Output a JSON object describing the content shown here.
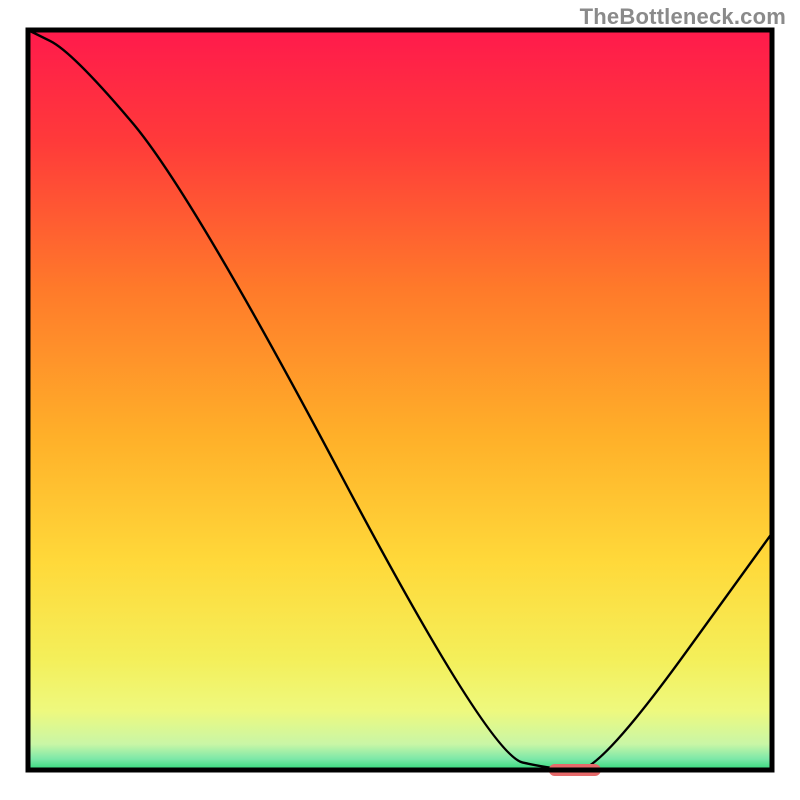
{
  "watermark": "TheBottleneck.com",
  "chart_data": {
    "type": "line",
    "title": "",
    "xlabel": "",
    "ylabel": "",
    "xlim": [
      0,
      100
    ],
    "ylim": [
      0,
      100
    ],
    "x": [
      0,
      6,
      22,
      62,
      71,
      77,
      100
    ],
    "values": [
      100,
      97,
      78,
      2,
      0,
      0,
      32
    ],
    "marker": {
      "x_start": 70,
      "x_end": 77,
      "y": 0
    },
    "gradient_stops": [
      {
        "offset": 0.0,
        "color": "#ff1a4c"
      },
      {
        "offset": 0.15,
        "color": "#ff3a3a"
      },
      {
        "offset": 0.35,
        "color": "#ff7a2a"
      },
      {
        "offset": 0.55,
        "color": "#ffb029"
      },
      {
        "offset": 0.72,
        "color": "#ffd93a"
      },
      {
        "offset": 0.85,
        "color": "#f4ef5a"
      },
      {
        "offset": 0.92,
        "color": "#eef97e"
      },
      {
        "offset": 0.965,
        "color": "#c9f6a6"
      },
      {
        "offset": 0.985,
        "color": "#7de8a8"
      },
      {
        "offset": 1.0,
        "color": "#2fd97a"
      }
    ],
    "marker_color": "#e66a6a",
    "border_color": "#000000",
    "curve_color": "#000000"
  }
}
